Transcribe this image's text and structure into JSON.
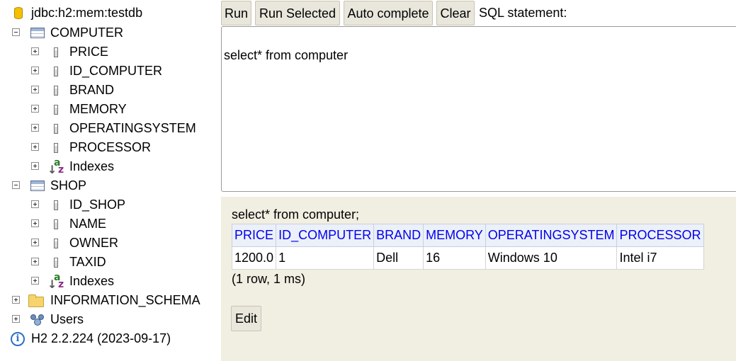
{
  "tree": {
    "connection": "jdbc:h2:mem:testdb",
    "tables": [
      {
        "name": "COMPUTER",
        "columns": [
          "PRICE",
          "ID_COMPUTER",
          "BRAND",
          "MEMORY",
          "OPERATINGSYSTEM",
          "PROCESSOR"
        ],
        "indexes_label": "Indexes"
      },
      {
        "name": "SHOP",
        "columns": [
          "ID_SHOP",
          "NAME",
          "OWNER",
          "TAXID"
        ],
        "indexes_label": "Indexes"
      }
    ],
    "schema": "INFORMATION_SCHEMA",
    "users": "Users",
    "version": "H2 2.2.224 (2023-09-17)"
  },
  "toolbar": {
    "run": "Run",
    "run_selected": "Run Selected",
    "auto_complete": "Auto complete",
    "clear": "Clear",
    "sql_label": "SQL statement:"
  },
  "editor": {
    "text": "select* from computer"
  },
  "results": {
    "query": "select* from computer;",
    "columns": [
      "PRICE",
      "ID_COMPUTER",
      "BRAND",
      "MEMORY",
      "OPERATINGSYSTEM",
      "PROCESSOR"
    ],
    "rows": [
      [
        "1200.0",
        "1",
        "Dell",
        "16",
        "Windows 10",
        "Intel i7"
      ]
    ],
    "summary": "(1 row, 1 ms)",
    "edit": "Edit"
  },
  "colors": {
    "link_blue": "#0000ee",
    "results_bg": "#f1efe2",
    "button_bg": "#e9e7dc"
  }
}
